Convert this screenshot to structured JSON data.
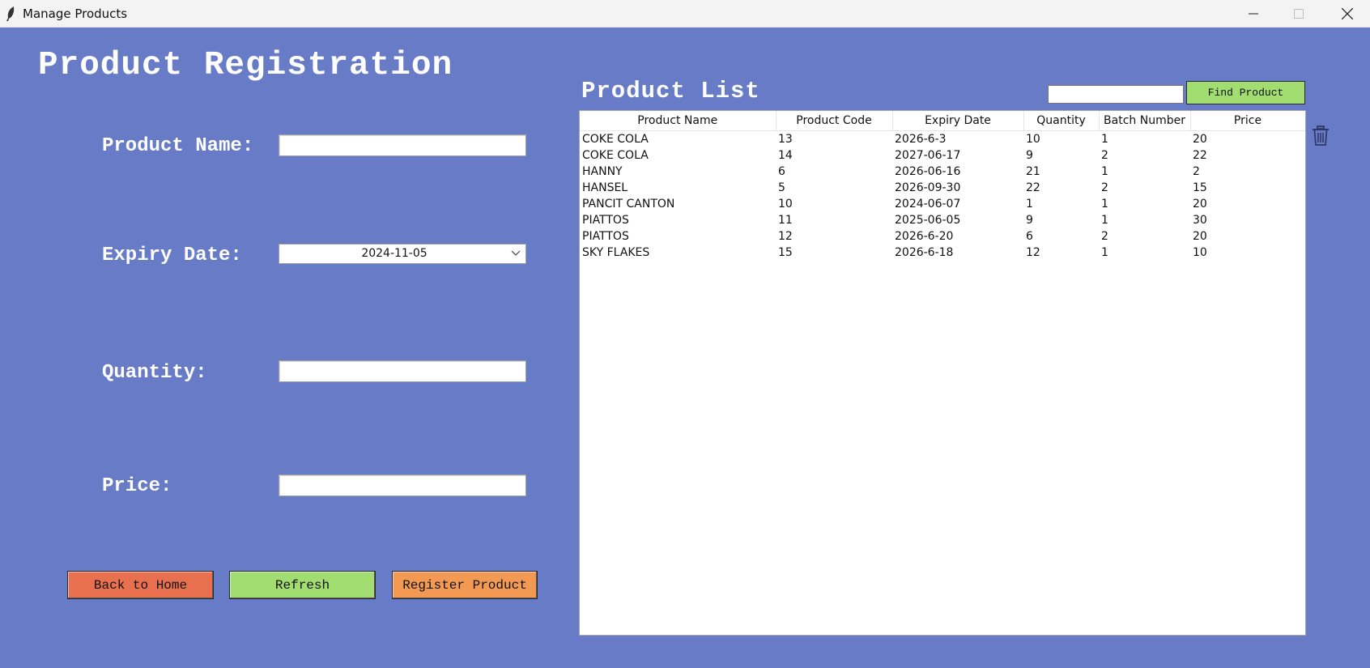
{
  "window": {
    "title": "Manage Products"
  },
  "registration": {
    "heading": "Product Registration",
    "labels": {
      "product_name": "Product Name:",
      "expiry_date": "Expiry Date:",
      "quantity": "Quantity:",
      "price": "Price:"
    },
    "fields": {
      "product_name": "",
      "expiry_date": "2024-11-05",
      "quantity": "",
      "price": ""
    },
    "buttons": {
      "back_home": "Back to Home",
      "refresh": "Refresh",
      "register": "Register Product"
    },
    "button_colors": {
      "back_home": "#e8704f",
      "refresh": "#a1dd71",
      "register": "#f29a53"
    }
  },
  "product_list": {
    "heading": "Product List",
    "search_value": "",
    "find_button": "Find Product",
    "delete_icon": "trash-icon",
    "columns": [
      "Product Name",
      "Product Code",
      "Expiry Date",
      "Quantity",
      "Batch Number",
      "Price"
    ],
    "rows": [
      [
        "COKE COLA",
        "13",
        "2026-6-3",
        "10",
        "1",
        "20"
      ],
      [
        "COKE COLA",
        "14",
        "2027-06-17",
        "9",
        "2",
        "22"
      ],
      [
        "HANNY",
        "6",
        "2026-06-16",
        "21",
        "1",
        "2"
      ],
      [
        "HANSEL",
        "5",
        "2026-09-30",
        "22",
        "2",
        "15"
      ],
      [
        "PANCIT CANTON",
        "10",
        "2024-06-07",
        "1",
        "1",
        "20"
      ],
      [
        "PIATTOS",
        "11",
        "2025-06-05",
        "9",
        "1",
        "30"
      ],
      [
        "PIATTOS",
        "12",
        "2026-6-20",
        "6",
        "2",
        "20"
      ],
      [
        "SKY FLAKES",
        "15",
        "2026-6-18",
        "12",
        "1",
        "10"
      ]
    ]
  },
  "theme": {
    "background": "#677bc6"
  }
}
